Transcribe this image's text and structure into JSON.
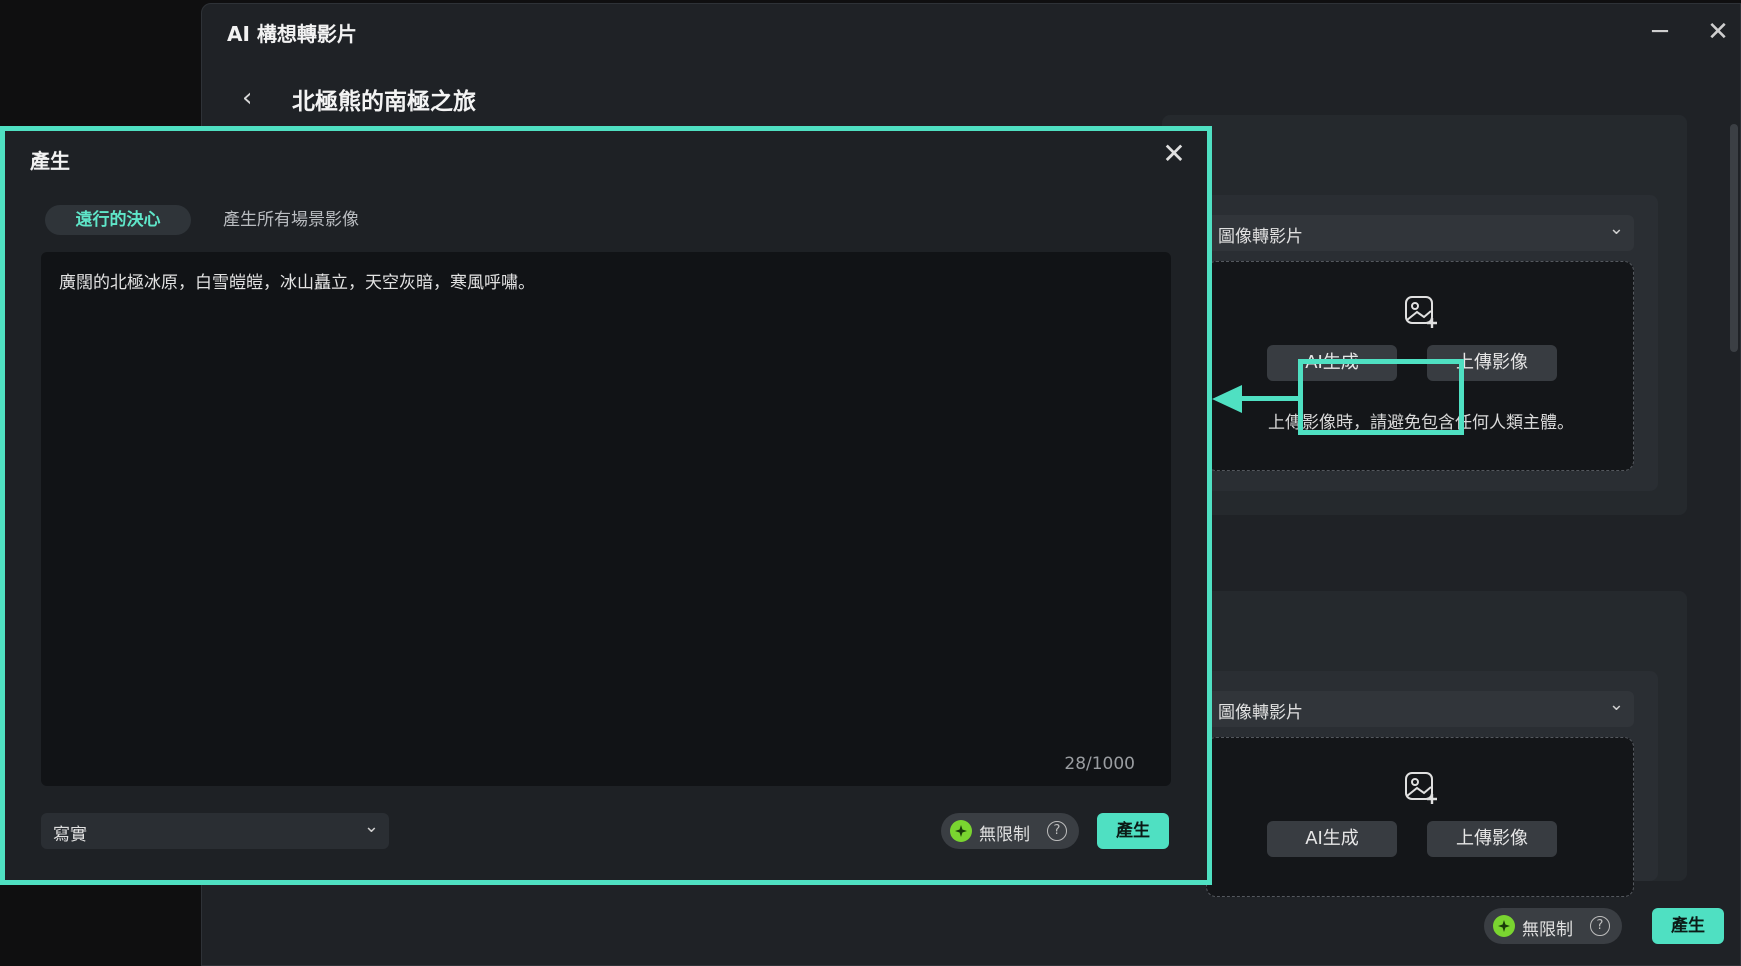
{
  "window": {
    "title": "AI 構想轉影片",
    "minimize_glyph": "─",
    "close_glyph": "✕",
    "back_glyph": "‹",
    "page_title": "北極熊的南極之旅"
  },
  "scenes": [
    {
      "mode_select": "圖像轉影片",
      "ai_generate_label": "AI生成",
      "upload_label": "上傳影像",
      "hint": "上傳影像時，請避免包含任何人類主體。"
    },
    {
      "mode_select": "圖像轉影片",
      "ai_generate_label": "AI生成",
      "upload_label": "上傳影像"
    }
  ],
  "footer": {
    "credit_label": "無限制",
    "help_glyph": "?",
    "generate_label": "產生"
  },
  "dialog": {
    "title": "產生",
    "close_glyph": "✕",
    "tabs": [
      {
        "label": "遠行的決心",
        "active": true
      },
      {
        "label": "產生所有場景影像",
        "active": false
      }
    ],
    "prompt_text": "廣闊的北極冰原，白雪皚皚，冰山矗立，天空灰暗，寒風呼嘯。",
    "char_count": "28/1000",
    "style_select": "寫實",
    "credit_label": "無限制",
    "help_glyph": "?",
    "generate_label": "產生"
  },
  "colors": {
    "accent": "#4fe0c2",
    "credit_gem": "#7ad530",
    "background": "#1f2226"
  }
}
